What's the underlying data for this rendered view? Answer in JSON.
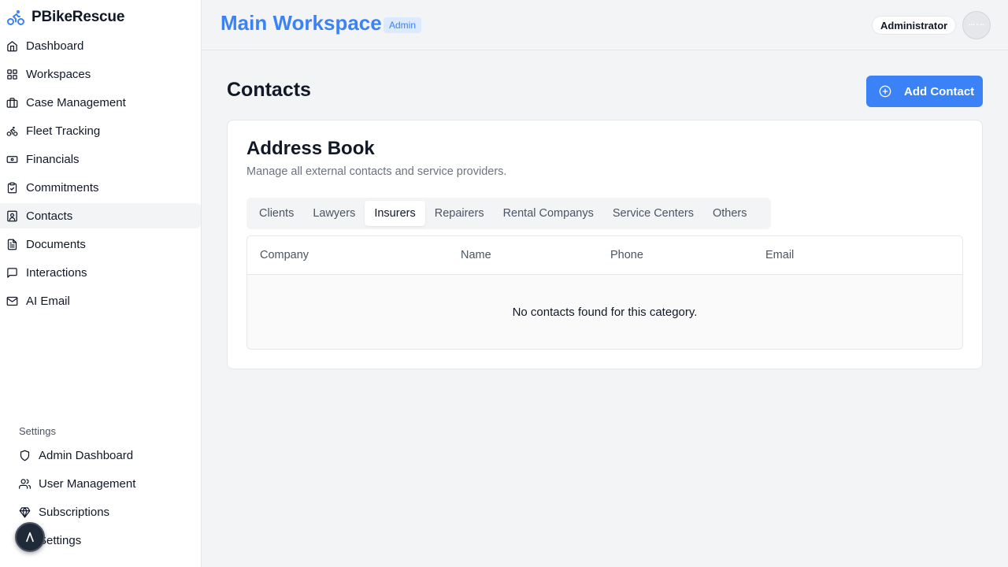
{
  "brand": {
    "name": "PBikeRescue"
  },
  "sidebar": {
    "items": [
      {
        "label": "Dashboard",
        "icon": "home-icon"
      },
      {
        "label": "Workspaces",
        "icon": "grid-icon"
      },
      {
        "label": "Case Management",
        "icon": "briefcase-icon"
      },
      {
        "label": "Fleet Tracking",
        "icon": "bike-icon"
      },
      {
        "label": "Financials",
        "icon": "banknote-icon"
      },
      {
        "label": "Commitments",
        "icon": "clipboard-check-icon"
      },
      {
        "label": "Contacts",
        "icon": "contact-icon",
        "active": true
      },
      {
        "label": "Documents",
        "icon": "file-text-icon"
      },
      {
        "label": "Interactions",
        "icon": "message-icon"
      },
      {
        "label": "AI Email",
        "icon": "mail-icon"
      }
    ],
    "settings_heading": "Settings",
    "settings_items": [
      {
        "label": "Admin Dashboard",
        "icon": "shield-icon"
      },
      {
        "label": "User Management",
        "icon": "users-icon"
      },
      {
        "label": "Subscriptions",
        "icon": "gem-icon"
      },
      {
        "label": "Settings",
        "icon": "gear-icon"
      }
    ]
  },
  "header": {
    "workspace_title": "Main Workspace",
    "badge": "Admin",
    "role": "Administrator",
    "avatar_text": "▪▪▪ ▪ ▪▪"
  },
  "main": {
    "title": "Contacts",
    "add_button": "Add Contact",
    "card": {
      "title": "Address Book",
      "subtitle": "Manage all external contacts and service providers.",
      "tabs": [
        "Clients",
        "Lawyers",
        "Insurers",
        "Repairers",
        "Rental Companys",
        "Service Centers",
        "Others"
      ],
      "active_tab": "Insurers",
      "columns": [
        "Company",
        "Name",
        "Phone",
        "Email"
      ],
      "empty_message": "No contacts found for this category."
    }
  },
  "colors": {
    "accent": "#3b82f6",
    "badge_bg": "#dbeafe",
    "background": "#f3f4f6"
  }
}
